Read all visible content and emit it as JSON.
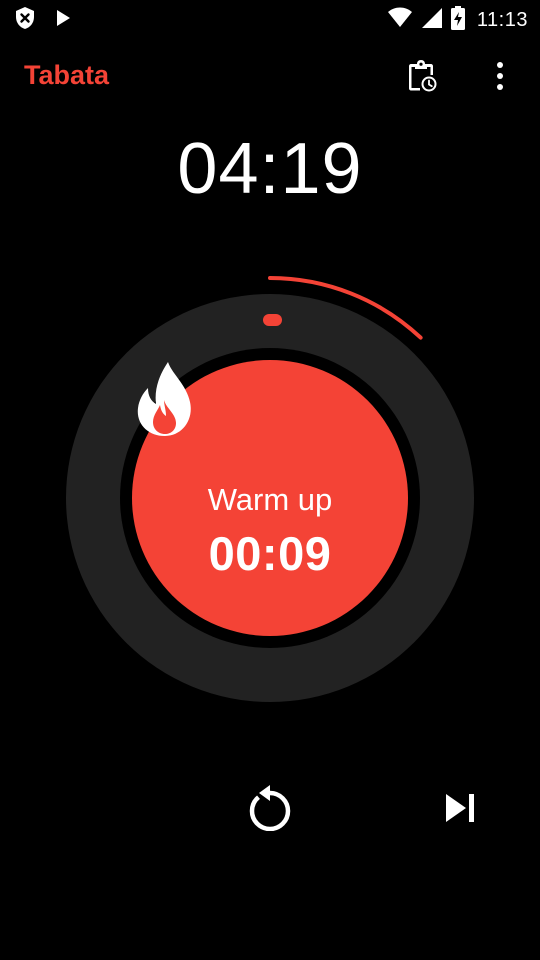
{
  "status_bar": {
    "time": "11:13",
    "icons": [
      "shield-x-icon",
      "play-store-icon",
      "wifi-icon",
      "cellular-icon",
      "battery-charging-icon"
    ]
  },
  "app_bar": {
    "title": "Tabata",
    "actions": [
      "clipboard-clock-icon",
      "more-vert-icon"
    ]
  },
  "total_time": "04:19",
  "dial": {
    "phase_icon": "fire-icon",
    "phase_label": "Warm up",
    "phase_time": "00:09",
    "progress_fraction": 0.12
  },
  "controls": {
    "icons": [
      "restart-icon",
      "skip-next-icon"
    ]
  },
  "colors": {
    "accent": "#f44336",
    "ring": "#222222",
    "background": "#000000",
    "text": "#ffffff"
  }
}
